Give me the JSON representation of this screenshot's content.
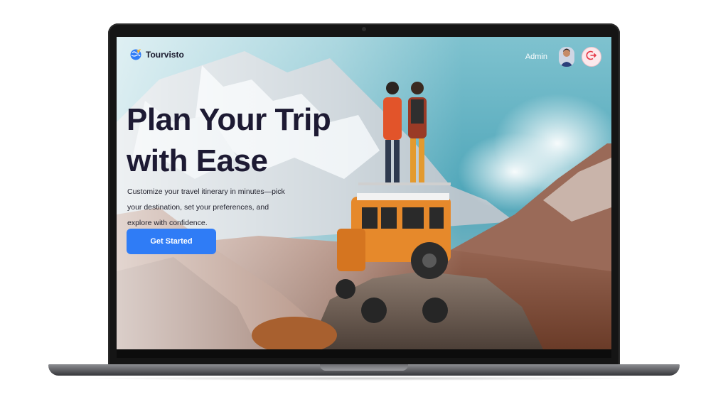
{
  "navbar": {
    "logo_icon": "globe-plane-icon",
    "brand_name": "Tourvisto",
    "user_name": "Admin",
    "avatar_icon": "user-avatar",
    "logout_icon": "logout-icon"
  },
  "hero": {
    "title_line1": "Plan Your Trip",
    "title_line2": "with Ease",
    "description": "Customize your travel itinerary in minutes—pick your destination, set your preferences, and explore with confidence.",
    "cta_label": "Get Started",
    "background_image": "mountain-jeep-travelers-photo"
  },
  "colors": {
    "primary_button": "#2f7cf6",
    "title_text": "#1d1a33",
    "logout_accent": "#e53946"
  }
}
